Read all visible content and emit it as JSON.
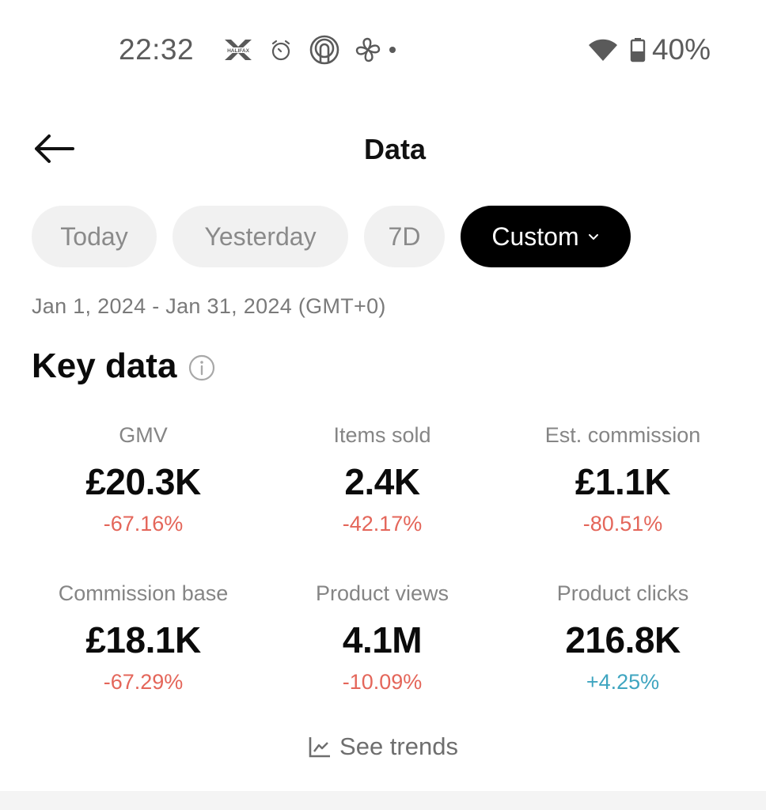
{
  "status_bar": {
    "time": "22:32",
    "notification_icons": [
      "halifax-app-icon",
      "alarm-icon",
      "find-my-device-icon",
      "fan-app-icon",
      "more-notifications-dot-icon"
    ],
    "halifax_label": "HALIFAX",
    "battery_percent": "40%",
    "icons_right": [
      "wifi-icon",
      "battery-icon"
    ]
  },
  "header": {
    "back_icon": "arrow-left-icon",
    "title": "Data"
  },
  "date_filters": {
    "options": [
      {
        "label": "Today",
        "selected": false
      },
      {
        "label": "Yesterday",
        "selected": false
      },
      {
        "label": "7D",
        "selected": false
      },
      {
        "label": "Custom",
        "selected": true
      }
    ]
  },
  "date_range": "Jan 1, 2024 - Jan 31, 2024 (GMT+0)",
  "key_data": {
    "title": "Key data",
    "info_icon": "info-icon",
    "metrics": [
      {
        "label": "GMV",
        "value": "£20.3K",
        "change": "-67.16%",
        "trend": "negative"
      },
      {
        "label": "Items sold",
        "value": "2.4K",
        "change": "-42.17%",
        "trend": "negative"
      },
      {
        "label": "Est. commission",
        "value": "£1.1K",
        "change": "-80.51%",
        "trend": "negative"
      },
      {
        "label": "Commission base",
        "value": "£18.1K",
        "change": "-67.29%",
        "trend": "negative"
      },
      {
        "label": "Product views",
        "value": "4.1M",
        "change": "-10.09%",
        "trend": "negative"
      },
      {
        "label": "Product clicks",
        "value": "216.8K",
        "change": "+4.25%",
        "trend": "positive"
      }
    ],
    "see_trends_label": "See trends"
  },
  "colors": {
    "negative": "#e4665a",
    "positive": "#3fa5c0",
    "active_chip_bg": "#000000",
    "chip_bg": "#f1f1f1"
  }
}
